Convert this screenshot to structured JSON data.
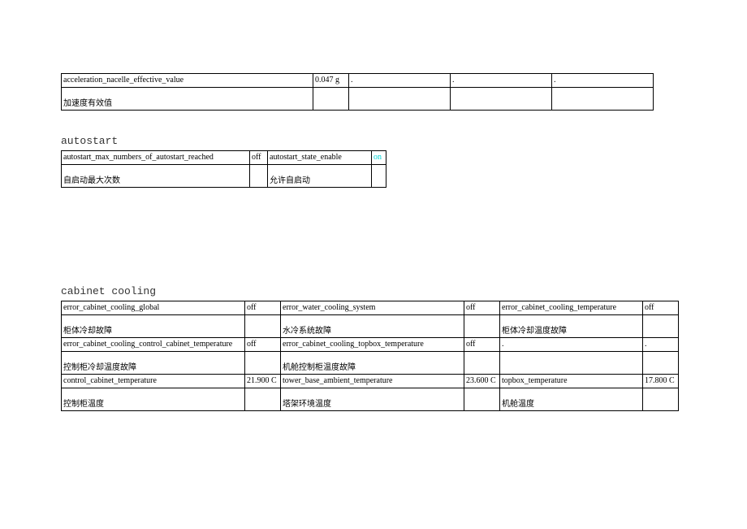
{
  "accel_table": {
    "rows": [
      {
        "label_en": "acceleration_nacelle_effective_value",
        "value": "0.047 g",
        "label_cn": "加速度有效值",
        "dots": [
          ".",
          ".",
          "."
        ]
      }
    ]
  },
  "autostart": {
    "title": "autostart",
    "rows": [
      {
        "c1_en": "autostart_max_numbers_of_autostart_reached",
        "c1_val": "off",
        "c1_cn": "自启动最大次数",
        "c2_en": "autostart_state_enable",
        "c2_val": "on",
        "c2_cn": "允许自启动"
      }
    ]
  },
  "cabinet": {
    "title": "cabinet cooling",
    "rows": [
      {
        "c1_en": "error_cabinet_cooling_global",
        "c1_val": "off",
        "c1_cn": "柜体冷却故障",
        "c2_en": "error_water_cooling_system",
        "c2_val": "off",
        "c2_cn": "水冷系统故障",
        "c3_en": "error_cabinet_cooling_temperature",
        "c3_val": "off",
        "c3_cn": "柜体冷却温度故障"
      },
      {
        "c1_en": "error_cabinet_cooling_control_cabinet_temperature",
        "c1_val": "off",
        "c1_cn": "控制柜冷却温度故障",
        "c2_en": "error_cabinet_cooling_topbox_temperature",
        "c2_val": "off",
        "c2_cn": "机舱控制柜温度故障",
        "c3_en": ".",
        "c3_val": ".",
        "c3_cn": ""
      },
      {
        "c1_en": "control_cabinet_temperature",
        "c1_val": "21.900 C",
        "c1_cn": "控制柜温度",
        "c2_en": "tower_base_ambient_temperature",
        "c2_val": "23.600 C",
        "c2_cn": "塔架环境温度",
        "c3_en": "topbox_temperature",
        "c3_val": "17.800 C",
        "c3_cn": "机舱温度"
      }
    ]
  }
}
